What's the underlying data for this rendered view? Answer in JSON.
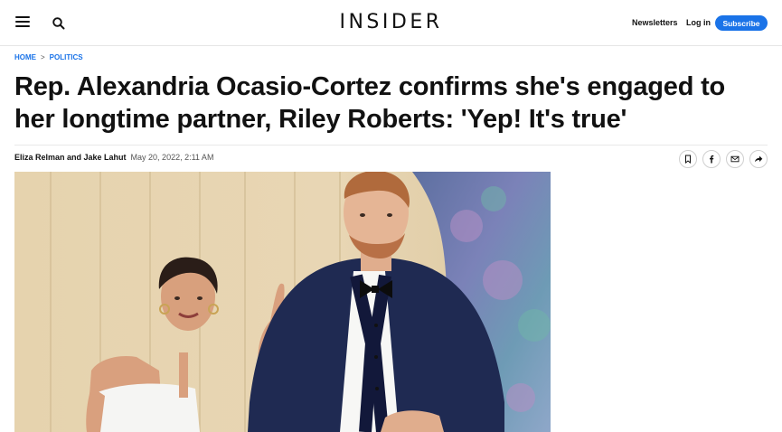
{
  "header": {
    "logo": "INSIDER",
    "menu_icon": "hamburger-menu-icon",
    "search_icon": "search-icon",
    "newsletters_label": "Newsletters",
    "login_label": "Log in",
    "subscribe_label": "Subscribe",
    "accent_color": "#1a73e8"
  },
  "breadcrumb": {
    "items": [
      "HOME",
      "POLITICS"
    ],
    "separator": ">"
  },
  "article": {
    "headline": "Rep. Alexandria Ocasio-Cortez confirms she's engaged to her longtime partner, Riley Roberts: 'Yep! It's true'",
    "authors": "Eliza Relman and Jake Lahut",
    "date": "May 20, 2022, 2:11 AM",
    "share_icons": [
      "bookmark-icon",
      "facebook-icon",
      "email-icon",
      "share-arrow-icon"
    ]
  }
}
